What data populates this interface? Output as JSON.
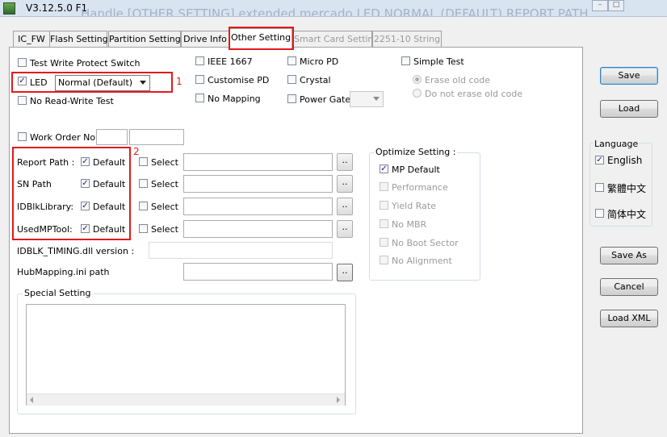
{
  "window": {
    "title": "V3.12.5.0 F1",
    "ghost_text": "Handle [OTHER SETTING] extended mercado LED NORMAL (DEFAULT) REPORT PATH"
  },
  "tabs": [
    {
      "label": "IC_FW",
      "active": false,
      "disabled": false
    },
    {
      "label": "Flash Setting",
      "active": false,
      "disabled": false
    },
    {
      "label": "Partition Setting",
      "active": false,
      "disabled": false
    },
    {
      "label": "Drive Info",
      "active": false,
      "disabled": false
    },
    {
      "label": "Other Setting",
      "active": true,
      "disabled": false
    },
    {
      "label": "Smart Card Setting",
      "active": false,
      "disabled": true
    },
    {
      "label": "2251-10 String",
      "active": false,
      "disabled": true
    }
  ],
  "options": {
    "test_write_protect": {
      "label": "Test Write Protect Switch",
      "checked": false
    },
    "led": {
      "label": "LED",
      "checked": true,
      "select_value": "Normal (Default)"
    },
    "no_read_write_test": {
      "label": "No Read-Write Test",
      "checked": false
    },
    "ieee_1667": {
      "label": "IEEE 1667",
      "checked": false
    },
    "customise_pd": {
      "label": "Customise PD",
      "checked": false
    },
    "no_mapping": {
      "label": "No Mapping",
      "checked": false
    },
    "micro_pd": {
      "label": "Micro PD",
      "checked": false
    },
    "crystal": {
      "label": "Crystal",
      "checked": false
    },
    "power_gate": {
      "label": "Power Gate",
      "checked": false
    },
    "simple_test": {
      "label": "Simple Test",
      "checked": false
    },
    "erase_old_code": {
      "label": "Erase old code",
      "selected": true
    },
    "do_not_erase_old_code": {
      "label": "Do not erase old code",
      "selected": false
    },
    "work_order": {
      "label": "Work Order No.",
      "checked": false
    }
  },
  "paths": {
    "rows": [
      {
        "label": "Report Path :",
        "default_label": "Default",
        "default_checked": true,
        "select_label": "Select",
        "select_checked": false,
        "dots": ".."
      },
      {
        "label": "SN Path",
        "default_label": "Default",
        "default_checked": true,
        "select_label": "Select",
        "select_checked": false,
        "dots": ".."
      },
      {
        "label": "IDBlkLibrary:",
        "default_label": "Default",
        "default_checked": true,
        "select_label": "Select",
        "select_checked": false,
        "dots": ".."
      },
      {
        "label": "UsedMPTool:",
        "default_label": "Default",
        "default_checked": true,
        "select_label": "Select",
        "select_checked": false,
        "dots": ".."
      }
    ],
    "idblk_version_label": "IDBLK_TIMING.dll version :",
    "hubmapping_label": "HubMapping.ini path",
    "hubmapping_dots": ".."
  },
  "optimize": {
    "title": "Optimize Setting :",
    "items": [
      {
        "label": "MP Default",
        "checked": true,
        "enabled": true
      },
      {
        "label": "Performance",
        "checked": false,
        "enabled": false
      },
      {
        "label": "Yield Rate",
        "checked": false,
        "enabled": false
      },
      {
        "label": "No MBR",
        "checked": false,
        "enabled": false
      },
      {
        "label": "No Boot Sector",
        "checked": false,
        "enabled": false
      },
      {
        "label": "No Alignment",
        "checked": false,
        "enabled": false
      }
    ]
  },
  "special_setting": {
    "title": "Special Setting"
  },
  "buttons": {
    "save": "Save",
    "load": "Load",
    "save_as": "Save As",
    "cancel": "Cancel",
    "load_xml": "Load XML"
  },
  "language": {
    "title": "Language",
    "items": [
      {
        "label": "English",
        "checked": true
      },
      {
        "label": "繁體中文",
        "checked": false
      },
      {
        "label": "简体中文",
        "checked": false
      }
    ]
  },
  "annotations": {
    "marker_1": "1",
    "marker_2": "2",
    "color": "#e21b1b"
  }
}
